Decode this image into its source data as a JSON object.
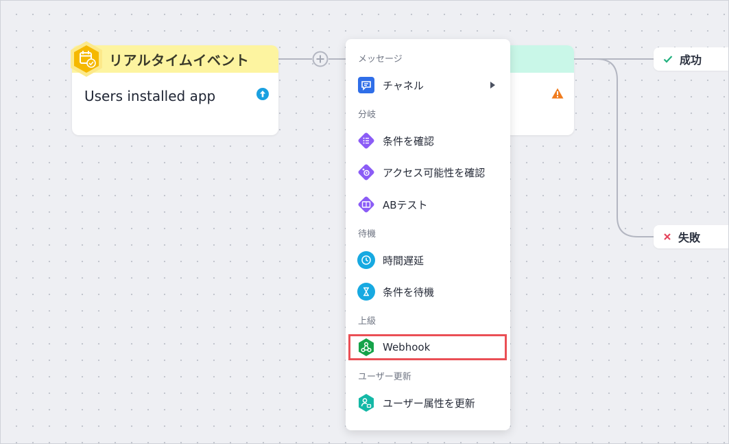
{
  "event_node": {
    "title": "リアルタイムイベント",
    "description": "Users installed app",
    "header_color": "#fdf4a0",
    "badge_color": "#f5b800"
  },
  "hidden_node": {
    "header_color": "#c9f7e8"
  },
  "outcomes": {
    "success_label": "成功",
    "failure_label": "失敗"
  },
  "menu": {
    "sections": {
      "message": "メッセージ",
      "branch": "分岐",
      "wait": "待機",
      "advanced": "上級",
      "user_update": "ユーザー更新"
    },
    "items": {
      "channel": "チャネル",
      "check_condition": "条件を確認",
      "check_reachability": "アクセス可能性を確認",
      "ab_test": "ABテスト",
      "time_delay": "時間遅延",
      "wait_condition": "条件を待機",
      "webhook": "Webhook",
      "update_user_attribute": "ユーザー属性を更新"
    },
    "icons": {
      "channel": "message-icon",
      "check_condition": "list-icon",
      "check_reachability": "reach-icon",
      "ab_test": "ab-icon",
      "time_delay": "clock-icon",
      "wait_condition": "hourglass-icon",
      "webhook": "webhook-icon",
      "update_user_attribute": "user-attribute-icon"
    },
    "highlight_color": "#ea4f55"
  }
}
